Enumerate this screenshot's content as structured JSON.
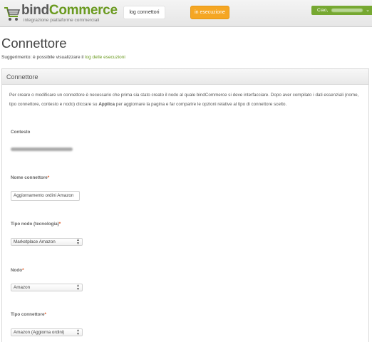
{
  "header": {
    "logo": {
      "name_part1": "bind",
      "name_part2": "Commerce",
      "tagline": "integrazione piattaforme commerciali"
    },
    "log_button": "log connettori",
    "exec_button": "in esecuzione",
    "user_greeting": "Ciao,",
    "icons": {
      "cart": "cart-icon",
      "user_menu": "chevron-down-icon"
    },
    "colors": {
      "accent": "#76a831",
      "exec": "#f5a623",
      "required": "#e0521c"
    }
  },
  "page": {
    "title": "Connettore",
    "hint_prefix": "Suggerimento: è possibile visualizzare il ",
    "hint_link": "log delle esecuzioni"
  },
  "panel": {
    "title": "Connettore",
    "intro_lead": "Per creare o modificare un connettore è necessario che prima sia stato creato il nodo al quale bindCommerce si deve interfacciare. Dopo aver compilato i dati essenziali (nome, tipo connettore, contesto e nodo) cliccare su ",
    "intro_action": "Applica",
    "intro_tail": " per aggiornare la pagina e far comparire le opzioni relative al tipo di connettore scelto.",
    "fields": {
      "context": {
        "label": "Contesto"
      },
      "name": {
        "label": "Nome connettore",
        "value": "Aggiornamento ordini Amazon"
      },
      "node_type": {
        "label": "Tipo nodo (tecnologia)",
        "selected": "Marketplace Amazon"
      },
      "node": {
        "label": "Nodo",
        "selected": "Amazon"
      },
      "connector_type": {
        "label": "Tipo connettore",
        "selected": "Amazon (Aggiorna ordini)"
      }
    },
    "required_mark": "*"
  }
}
